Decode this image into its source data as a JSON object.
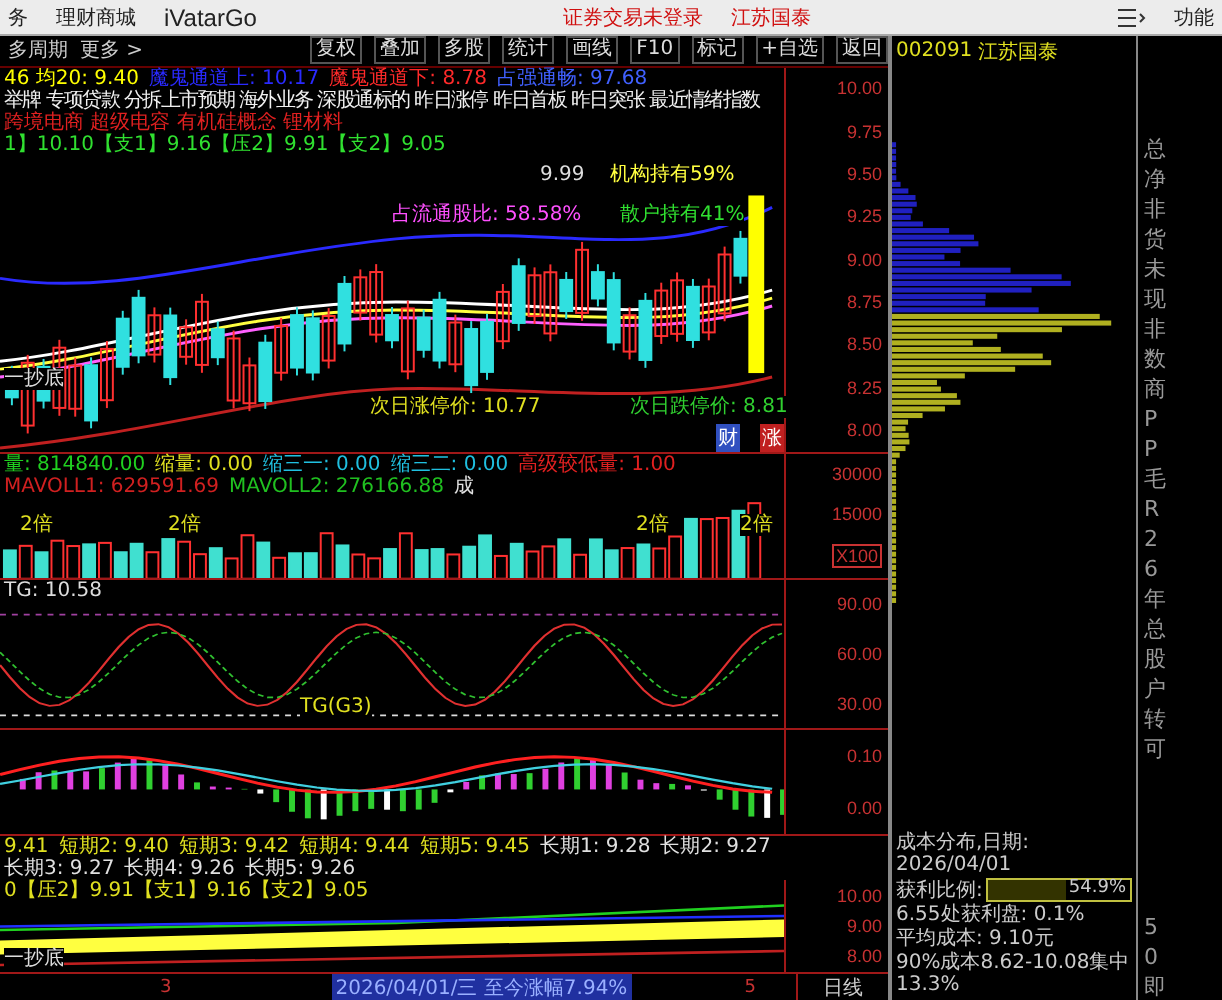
{
  "top_bar": {
    "menu_items": [
      "务",
      "理财商城",
      "iVatarGo"
    ],
    "login_status": "证券交易未登录",
    "stock_name": "江苏国泰",
    "function_label": "功能"
  },
  "toolbar": {
    "left_items": [
      "多周期",
      "更多 >"
    ],
    "buttons": [
      "复权",
      "叠加",
      "多股",
      "统计",
      "画线",
      "F10",
      "标记",
      "+自选",
      "返回"
    ]
  },
  "price_panel": {
    "indicators": [
      {
        "text": "46 均20: 9.40",
        "color": "#ffff00"
      },
      {
        "text": "魔鬼通道上: 10.17",
        "color": "#2a2aff"
      },
      {
        "text": "魔鬼通道下: 8.78",
        "color": "#ff2a2a"
      },
      {
        "text": "占强通畅: 97.68",
        "color": "#4060ff"
      }
    ],
    "concepts": "举牌 专项贷款 分拆上市预期 海外业务 深股通标的 昨日涨停 昨日首板 昨日突张 最近情绪指数",
    "themes": "跨境电商 超级电容 有机硅概念 锂材料",
    "levels": "1】10.10【支1】9.16【压2】9.91【支2】9.05",
    "institution_holding": "机构持有59%",
    "retail_holding": "散户持有41%",
    "float_ratio": "占流通股比: 58.58%",
    "high_mark": "9.99",
    "signal": "一抄底",
    "limit_up": "次日涨停价: 10.77",
    "limit_down": "次日跌停价: 8.81",
    "badges": [
      {
        "text": "财",
        "color": "#3050c0"
      },
      {
        "text": "涨",
        "color": "#c02020"
      }
    ],
    "axis": [
      "10.00",
      "9.75",
      "9.50",
      "9.25",
      "9.00",
      "8.75",
      "8.50",
      "8.25",
      "8.00"
    ]
  },
  "volume_panel": {
    "indicators": [
      {
        "text": "量: 814840.00",
        "color": "#20d020"
      },
      {
        "text": "缩量: 0.00",
        "color": "#e0e020"
      },
      {
        "text": "缩三一: 0.00",
        "color": "#20c0e0"
      },
      {
        "text": "缩三二: 0.00",
        "color": "#20c0e0"
      },
      {
        "text": "高级较低量: 1.00",
        "color": "#e02020"
      },
      {
        "text": "MAVOLL1: 629591.69",
        "color": "#d02020"
      },
      {
        "text": "MAVOLL2: 276166.88",
        "color": "#20c020"
      },
      {
        "text": "成",
        "color": "#e0e0e0"
      }
    ],
    "marks": [
      "2倍",
      "2倍",
      "2倍",
      "2倍"
    ],
    "axis": [
      "30000",
      "15000"
    ],
    "unit": "X100"
  },
  "tg_panel": {
    "title": "TG: 10.58",
    "label": "TG(G3)",
    "axis": [
      "90.00",
      "60.00",
      "30.00"
    ]
  },
  "macd_panel": {
    "axis": [
      "0.10",
      "0.00"
    ]
  },
  "ma_line": [
    {
      "text": "9.41",
      "color": "#e0e020"
    },
    {
      "text": "短期2: 9.40",
      "color": "#e0e020"
    },
    {
      "text": "短期3: 9.42",
      "color": "#e0e020"
    },
    {
      "text": "短期4: 9.44",
      "color": "#e0e020"
    },
    {
      "text": "短期5: 9.45",
      "color": "#e0e020"
    },
    {
      "text": "长期1: 9.28",
      "color": "#e0e0e0"
    },
    {
      "text": "长期2: 9.27",
      "color": "#e0e0e0"
    },
    {
      "text": "长期3: 9.27",
      "color": "#e0e0e0"
    },
    {
      "text": "长期4: 9.26",
      "color": "#e0e0e0"
    },
    {
      "text": "长期5: 9.26",
      "color": "#e0e0e0"
    }
  ],
  "mini_panel": {
    "levels": "0【压2】9.91【支1】9.16【支2】9.05",
    "signal": "一抄底",
    "axis": [
      "10.00",
      "9.00",
      "8.00"
    ]
  },
  "status_row": {
    "left_mark": "3",
    "date_info": "2026/04/01/三  至今涨幅7.94%",
    "right_mark": "5",
    "period": "日线"
  },
  "cost_panel": {
    "code": "002091",
    "name": "江苏国泰",
    "title": "成本分布,日期: 2026/04/01",
    "profit_label": "获利比例:",
    "profit": {
      "level": 0.549,
      "reading": "54.9%"
    },
    "lines": [
      "6.55处获利盘: 0.1%",
      "平均成本: 9.10元",
      "90%成本8.62-10.08集中13.3%"
    ]
  },
  "side_strip": {
    "chars": [
      "总",
      "净",
      "非",
      "货",
      "未",
      "现",
      "非",
      "数",
      "商",
      "P",
      "P",
      "毛",
      "R",
      "2",
      "6",
      "年",
      "总",
      "股",
      "户",
      "转",
      "可"
    ],
    "bottom_chars": [
      "5",
      "0",
      "即"
    ]
  }
}
